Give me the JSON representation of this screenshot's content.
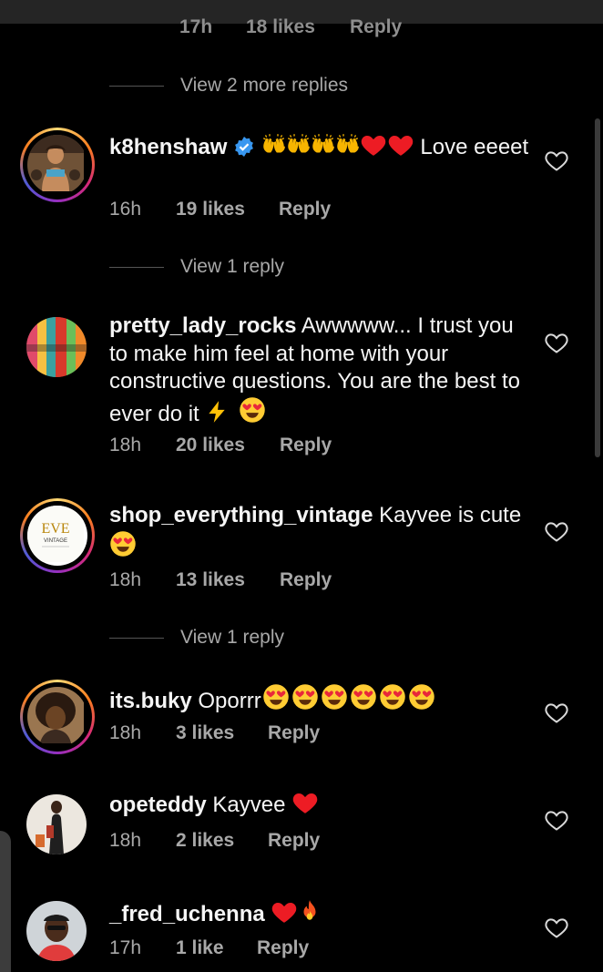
{
  "top_partial": {
    "time": "17h",
    "likes": "18 likes",
    "reply": "Reply"
  },
  "view_more_1": "View 2 more replies",
  "view_more_2": "View 1 reply",
  "view_more_3": "View 1 reply",
  "comments": [
    {
      "username": "k8henshaw",
      "text": "Love eeeet",
      "time": "16h",
      "likes": "19 likes",
      "reply": "Reply",
      "verified": true,
      "emojis": [
        "raised-hands-icon",
        "raised-hands-icon",
        "raised-hands-icon",
        "raised-hands-icon",
        "red-heart-icon",
        "red-heart-icon"
      ]
    },
    {
      "username": "pretty_lady_rocks",
      "text": "Awwwww... I trust you to make him feel at home with your constructive questions. You are the best to ever do it",
      "time": "18h",
      "likes": "20 likes",
      "reply": "Reply",
      "emojis": [
        "lightning-icon",
        "heart-eyes-icon"
      ]
    },
    {
      "username": "shop_everything_vintage",
      "text": "Kayvee is cute",
      "time": "18h",
      "likes": "13 likes",
      "reply": "Reply",
      "emojis": [
        "heart-eyes-icon"
      ]
    },
    {
      "username": "its.buky",
      "text": "Oporrr",
      "time": "18h",
      "likes": "3 likes",
      "reply": "Reply",
      "emojis": [
        "heart-eyes-icon",
        "heart-eyes-icon",
        "heart-eyes-icon",
        "heart-eyes-icon",
        "heart-eyes-icon",
        "heart-eyes-icon"
      ]
    },
    {
      "username": "opeteddy",
      "text": "Kayvee",
      "time": "18h",
      "likes": "2 likes",
      "reply": "Reply",
      "emojis": [
        "red-heart-icon"
      ]
    },
    {
      "username": "_fred_uchenna",
      "text": "",
      "time": "17h",
      "likes": "1 like",
      "reply": "Reply",
      "emojis": [
        "red-heart-icon",
        "fire-icon"
      ]
    }
  ],
  "colors": {
    "background": "#000000",
    "text": "#f5f5f5",
    "secondary": "#a8a8a8",
    "verified": "#3897f0",
    "heart": "#ed1c24"
  },
  "avatar_logo_text": "VINTAGE"
}
